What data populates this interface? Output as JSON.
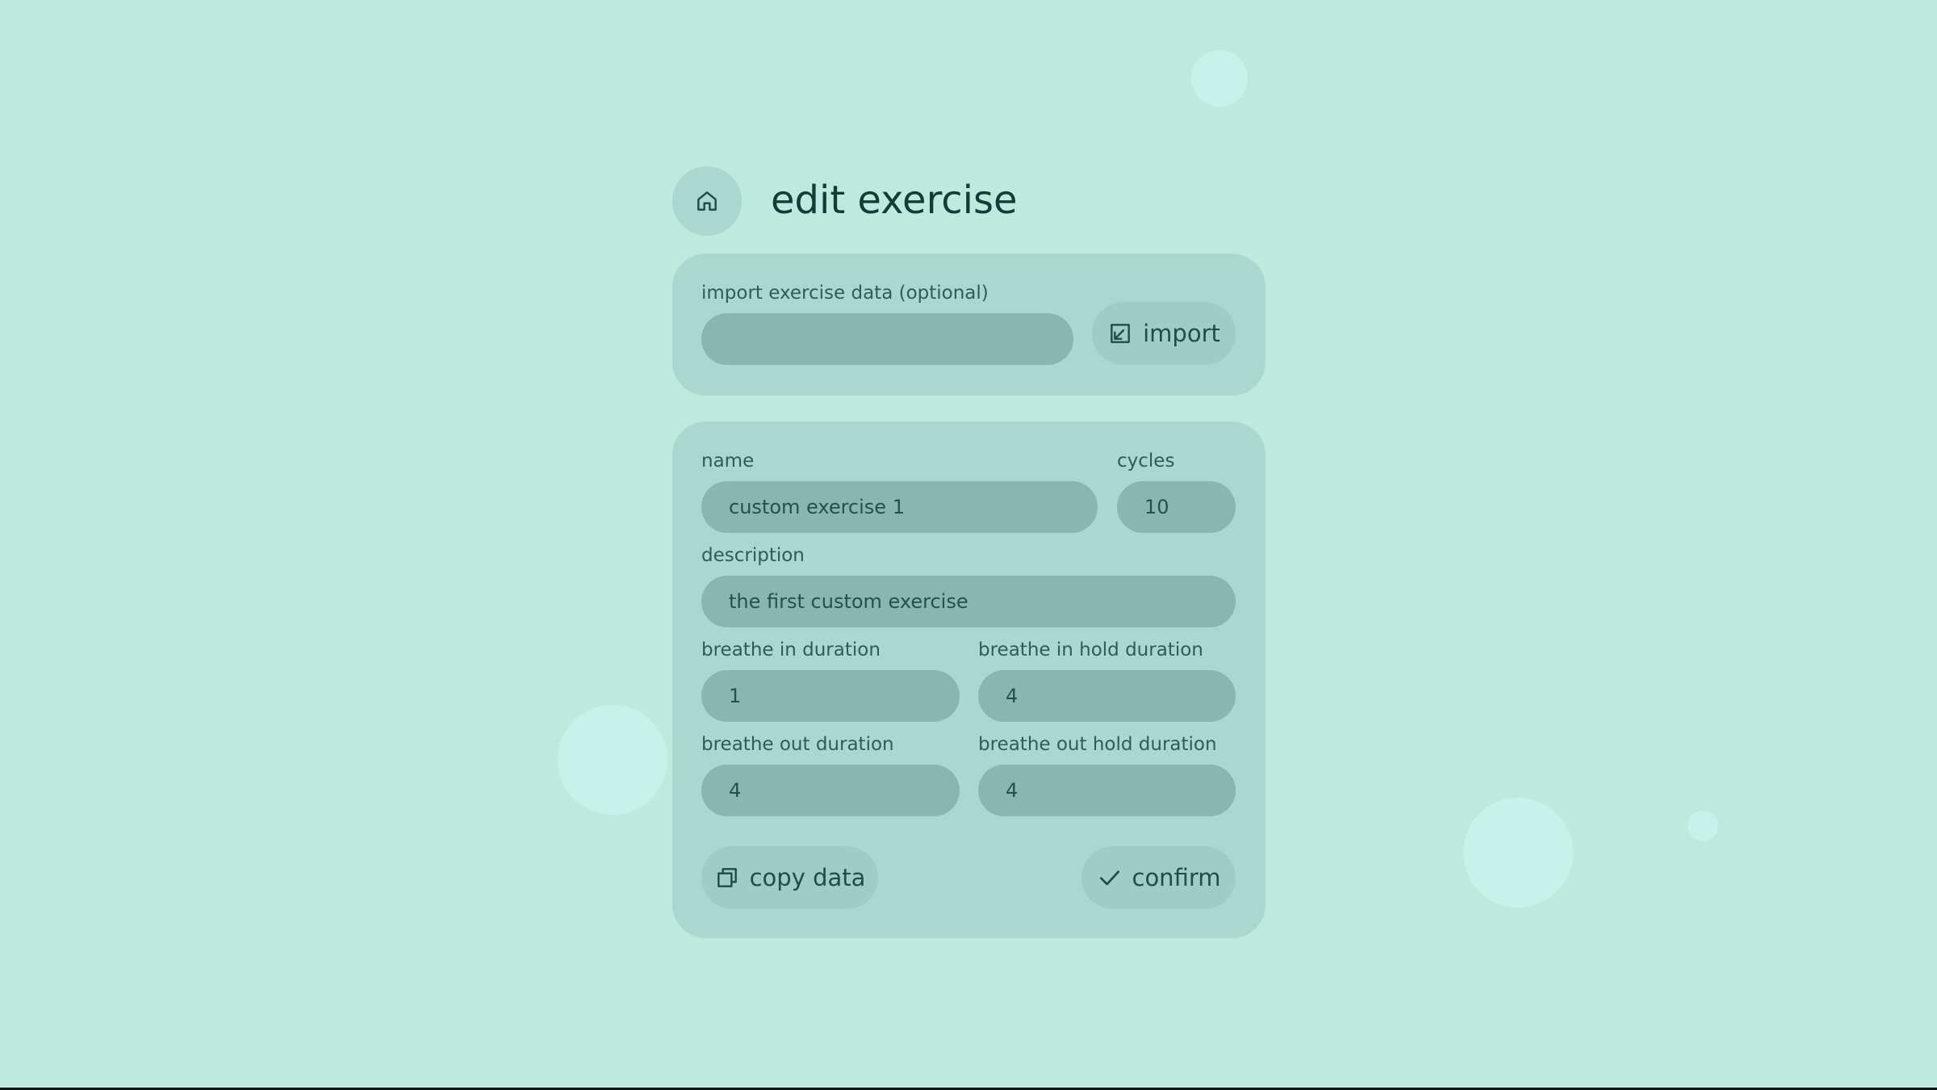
{
  "header": {
    "title": "edit exercise",
    "home_icon": "home-icon"
  },
  "import_section": {
    "label": "import exercise data (optional)",
    "input_value": "",
    "button_label": "import",
    "button_icon": "import-arrow-icon"
  },
  "form": {
    "name": {
      "label": "name",
      "value": "custom exercise 1"
    },
    "cycles": {
      "label": "cycles",
      "value": "10"
    },
    "description": {
      "label": "description",
      "value": "the first custom exercise"
    },
    "breathe_in": {
      "label": "breathe in duration",
      "value": "1"
    },
    "breathe_in_hold": {
      "label": "breathe in hold duration",
      "value": "4"
    },
    "breathe_out": {
      "label": "breathe out duration",
      "value": "4"
    },
    "breathe_out_hold": {
      "label": "breathe out hold duration",
      "value": "4"
    }
  },
  "actions": {
    "copy_label": "copy data",
    "copy_icon": "copy-icon",
    "confirm_label": "confirm",
    "confirm_icon": "check-icon"
  },
  "colors": {
    "background": "#bde9df",
    "card": "#a9d8cf",
    "input": "#88b7ad",
    "text": "#123c36"
  }
}
